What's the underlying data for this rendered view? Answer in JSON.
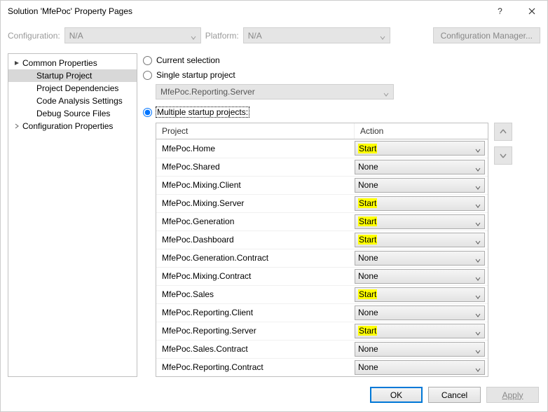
{
  "window": {
    "title": "Solution 'MfePoc' Property Pages"
  },
  "configRow": {
    "configurationLabel": "Configuration:",
    "configurationValue": "N/A",
    "platformLabel": "Platform:",
    "platformValue": "N/A",
    "configManagerLabel": "Configuration Manager..."
  },
  "tree": {
    "commonProps": "Common Properties",
    "startupProject": "Startup Project",
    "projectDeps": "Project Dependencies",
    "codeAnalysis": "Code Analysis Settings",
    "debugSource": "Debug Source Files",
    "configProps": "Configuration Properties"
  },
  "radios": {
    "currentSelection": "Current selection",
    "singleStartup": "Single startup project",
    "singleStartupValue": "MfePoc.Reporting.Server",
    "multipleStartup": "Multiple startup projects:"
  },
  "table": {
    "headProject": "Project",
    "headAction": "Action",
    "rows": [
      {
        "project": "MfePoc.Home",
        "action": "Start",
        "hl": true
      },
      {
        "project": "MfePoc.Shared",
        "action": "None",
        "hl": false
      },
      {
        "project": "MfePoc.Mixing.Client",
        "action": "None",
        "hl": false
      },
      {
        "project": "MfePoc.Mixing.Server",
        "action": "Start",
        "hl": true
      },
      {
        "project": "MfePoc.Generation",
        "action": "Start",
        "hl": true
      },
      {
        "project": "MfePoc.Dashboard",
        "action": "Start",
        "hl": true
      },
      {
        "project": "MfePoc.Generation.Contract",
        "action": "None",
        "hl": false
      },
      {
        "project": "MfePoc.Mixing.Contract",
        "action": "None",
        "hl": false
      },
      {
        "project": "MfePoc.Sales",
        "action": "Start",
        "hl": true
      },
      {
        "project": "MfePoc.Reporting.Client",
        "action": "None",
        "hl": false
      },
      {
        "project": "MfePoc.Reporting.Server",
        "action": "Start",
        "hl": true
      },
      {
        "project": "MfePoc.Sales.Contract",
        "action": "None",
        "hl": false
      },
      {
        "project": "MfePoc.Reporting.Contract",
        "action": "None",
        "hl": false
      }
    ]
  },
  "buttons": {
    "ok": "OK",
    "cancel": "Cancel",
    "apply": "Apply"
  }
}
